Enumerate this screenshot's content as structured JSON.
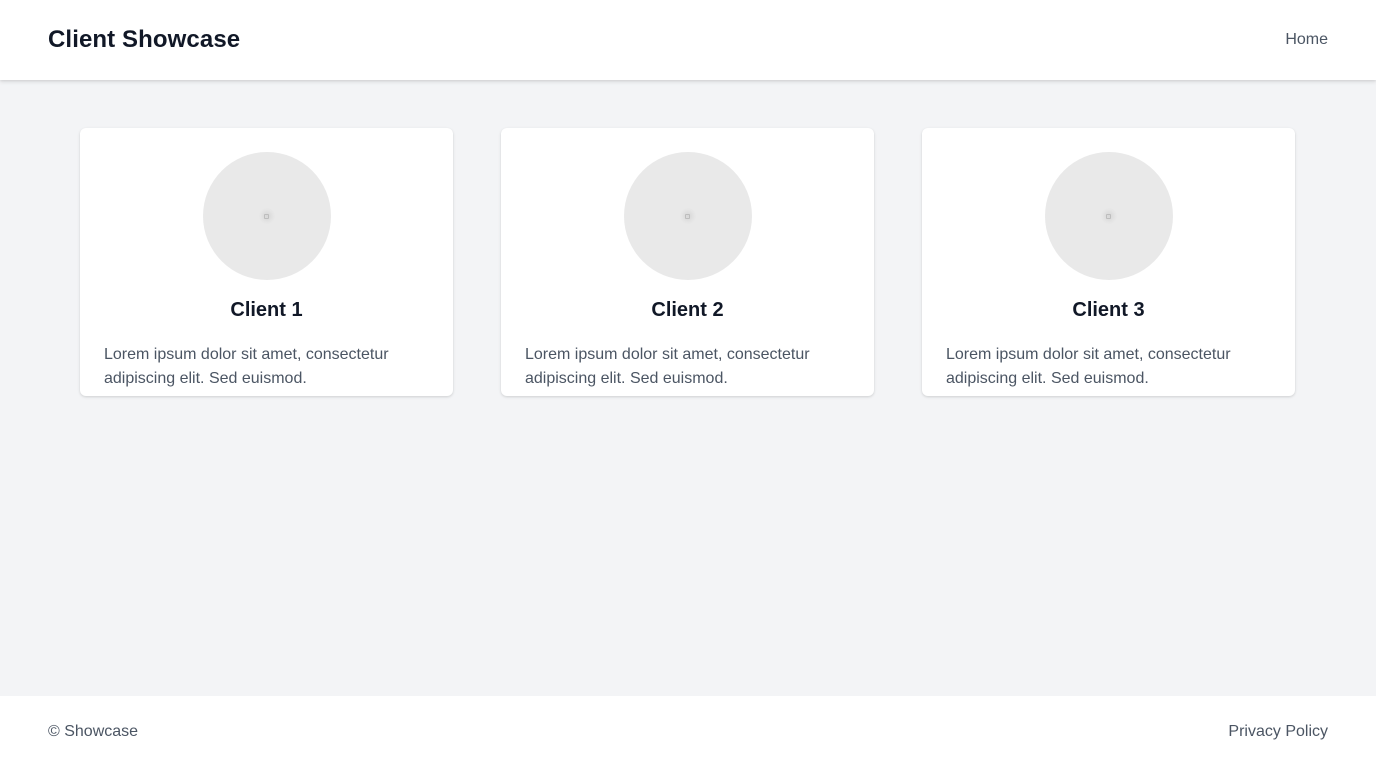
{
  "header": {
    "title": "Client Showcase",
    "nav": [
      {
        "label": "Home"
      }
    ]
  },
  "clients": [
    {
      "name": "Client 1",
      "description": "Lorem ipsum dolor sit amet, consectetur adipiscing elit. Sed euismod.",
      "avatar_icon": "placeholder-image-icon"
    },
    {
      "name": "Client 2",
      "description": "Lorem ipsum dolor sit amet, consectetur adipiscing elit. Sed euismod.",
      "avatar_icon": "placeholder-image-icon"
    },
    {
      "name": "Client 3",
      "description": "Lorem ipsum dolor sit amet, consectetur adipiscing elit. Sed euismod.",
      "avatar_icon": "placeholder-image-icon"
    }
  ],
  "footer": {
    "copyright": "© Showcase",
    "links": [
      {
        "label": "Privacy Policy"
      }
    ]
  },
  "colors": {
    "page_background": "#f3f4f6",
    "surface": "#ffffff",
    "heading_text": "#111827",
    "body_text": "#4b5563",
    "avatar_placeholder": "#e9e9e9"
  }
}
